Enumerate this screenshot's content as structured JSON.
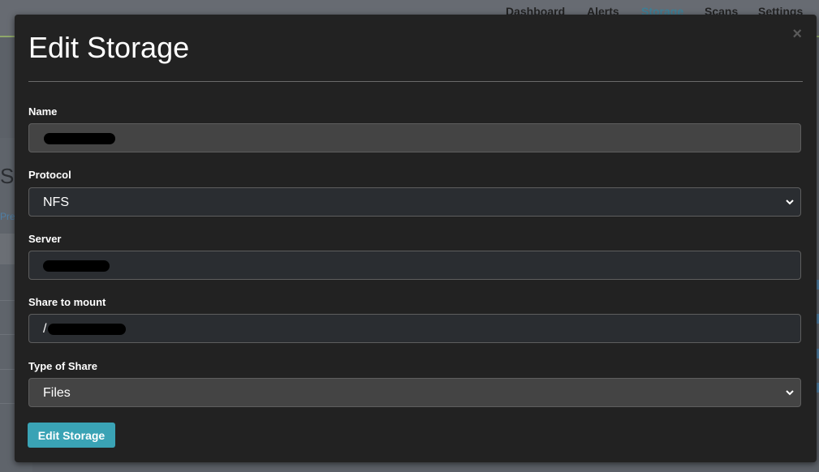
{
  "nav": {
    "items": [
      {
        "label": "Dashboard",
        "active": false
      },
      {
        "label": "Alerts",
        "active": false
      },
      {
        "label": "Storage",
        "active": true
      },
      {
        "label": "Scans",
        "active": false
      },
      {
        "label": "Settings",
        "active": false
      }
    ]
  },
  "background": {
    "heading_fragment": "S",
    "link_fragment": "Pre"
  },
  "modal": {
    "title": "Edit Storage",
    "close_glyph": "×",
    "fields": {
      "name": {
        "label": "Name",
        "value": ""
      },
      "protocol": {
        "label": "Protocol",
        "value": "NFS"
      },
      "server": {
        "label": "Server",
        "value": ""
      },
      "share": {
        "label": "Share to mount",
        "value": "/"
      },
      "share_type": {
        "label": "Type of Share",
        "value": "Files"
      }
    },
    "submit_label": "Edit Storage"
  },
  "colors": {
    "accent": "#3aa3b5",
    "modal_bg": "#222222",
    "nav_active": "#3d7f96"
  },
  "icons": {
    "close": "close-icon",
    "select_arrow": "chevron-down-icon"
  }
}
